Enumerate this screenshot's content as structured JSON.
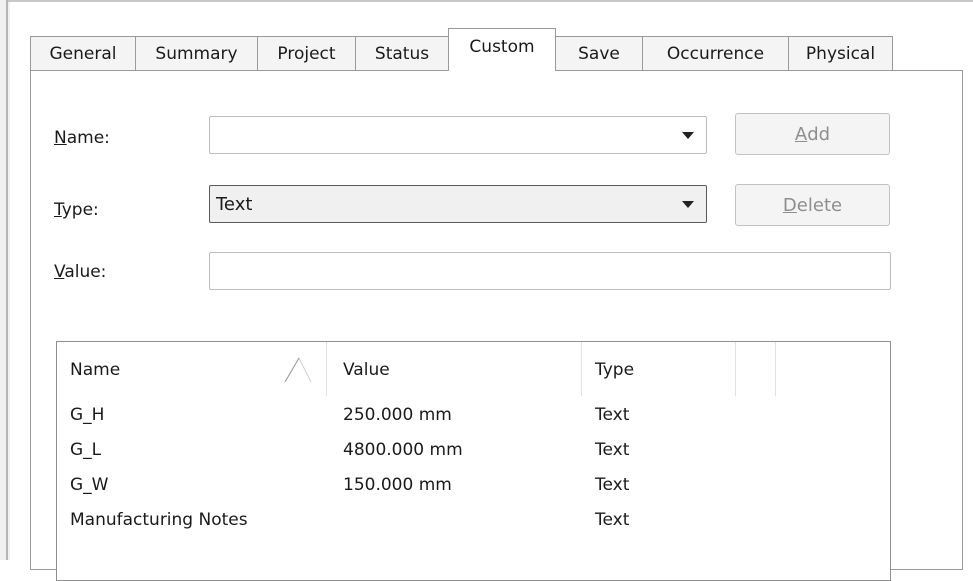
{
  "tabs": [
    {
      "label": "General"
    },
    {
      "label": "Summary"
    },
    {
      "label": "Project"
    },
    {
      "label": "Status"
    },
    {
      "label": "Custom",
      "active": true
    },
    {
      "label": "Save"
    },
    {
      "label": "Occurrence"
    },
    {
      "label": "Physical"
    }
  ],
  "form": {
    "name_label_u": "N",
    "name_label_rest": "ame:",
    "name_value": "",
    "type_label_u": "T",
    "type_label_rest": "ype:",
    "type_value": "Text",
    "value_label_u": "V",
    "value_label_rest": "alue:",
    "value_value": ""
  },
  "buttons": {
    "add_u": "A",
    "add_rest": "dd",
    "delete_u": "D",
    "delete_rest": "elete"
  },
  "table": {
    "headers": {
      "name": "Name",
      "value": "Value",
      "type": "Type"
    },
    "rows": [
      {
        "name": "G_H",
        "value": "250.000 mm",
        "type": "Text"
      },
      {
        "name": "G_L",
        "value": "4800.000 mm",
        "type": "Text"
      },
      {
        "name": "G_W",
        "value": "150.000 mm",
        "type": "Text"
      },
      {
        "name": "Manufacturing Notes",
        "value": "",
        "type": "Text"
      }
    ]
  }
}
